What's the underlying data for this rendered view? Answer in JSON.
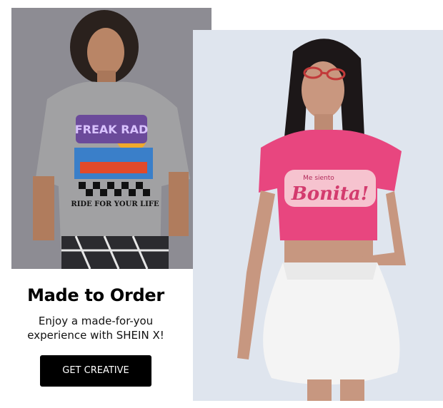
{
  "promo": {
    "title": "Made to Order",
    "subtitle_line1": "Enjoy a made-for-you",
    "subtitle_line2": "experience with SHEIN X!",
    "cta_label": "GET CREATIVE"
  },
  "images": {
    "left": {
      "description_icon": "model-photo",
      "shirt_graphic_text_top": "FREAK RAD",
      "shirt_graphic_text_bottom": "RIDE FOR YOUR LIFE"
    },
    "right": {
      "description_icon": "model-photo",
      "shirt_graphic_text_small": "Me siento",
      "shirt_graphic_text_large": "Bonita!"
    }
  },
  "colors": {
    "cta_background": "#000000",
    "cta_text": "#ffffff",
    "left_bg": "#8b8a90",
    "right_bg": "#dde3ec",
    "pink_top": "#e8467f"
  }
}
